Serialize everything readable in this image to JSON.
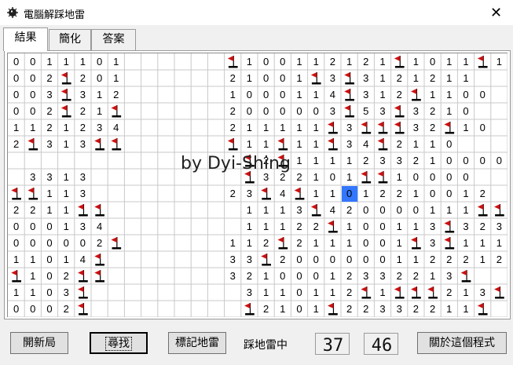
{
  "window": {
    "title": "電腦解踩地雷",
    "close_glyph": "✕",
    "icon": "mine-icon"
  },
  "tabs": [
    {
      "label": "結果",
      "active": true
    },
    {
      "label": "簡化",
      "active": false
    },
    {
      "label": "答案",
      "active": false
    }
  ],
  "board": {
    "columns": 30,
    "rows": [
      "0011101......*100112121*1011*1",
      "002*201......2100 1*3*31212 11",
      "003*312......1000114*312*1100",
      "002*21*......2000003*53*3210",
      "112123 4......211111*3***32*10",
      "2*313**......*11*11*34*2110",
      "..............*2*1111233210000",
      ".3313.........*3221 01**10000",
      "**113........23*4*1101221 0012",
      "2211**........11 13*42000011 1**",
      "00013 4........111 22*1001 13*3233",
      "000002*......112*2111001*3*111",
      "11014*.......33*2000000112221 22",
      "*102**.......3210001233221 3*",
      "1103*.........31101 12*1***213*1",
      "0002*.........*2101*22332211*"
    ],
    "highlight": {
      "row": 8,
      "col": 20
    },
    "colors": {
      "mine": "#cc1111",
      "highlight": "#3377ff",
      "grid": "#c8c8c8"
    }
  },
  "watermark": "by Dyi-Shing",
  "buttons": {
    "new_game": "開新局",
    "search": "尋找",
    "mark_mines": "標記地雷",
    "about": "關於這個程式"
  },
  "status": {
    "label": "踩地雷中",
    "mines_remaining": "37",
    "time": "46"
  }
}
